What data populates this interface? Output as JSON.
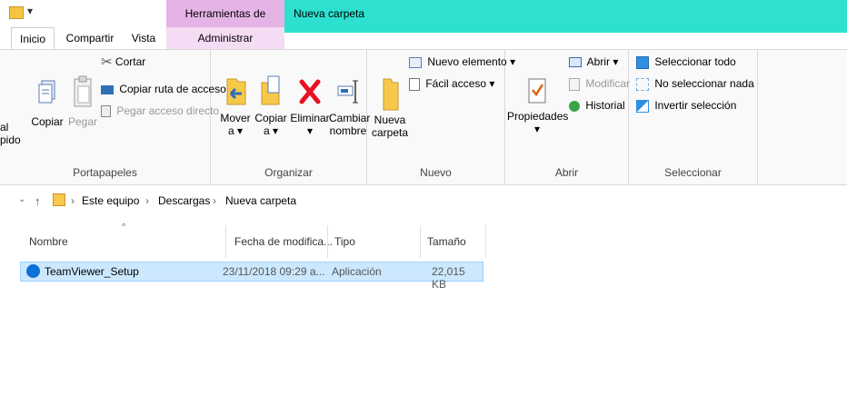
{
  "titlebar": {
    "app_tools_label": "Herramientas de aplicación",
    "window_title": "Nueva carpeta"
  },
  "tabs": {
    "inicio": "Inicio",
    "compartir": "Compartir",
    "vista": "Vista",
    "administrar": "Administrar"
  },
  "ribbon": {
    "portapapeles": {
      "label": "Portapapeles",
      "cut_partial_top": "al",
      "cut_partial_bottom": "pido",
      "copy": "Copiar",
      "paste": "Pegar",
      "cut": "Cortar",
      "copy_path": "Copiar ruta de acceso",
      "paste_shortcut": "Pegar acceso directo"
    },
    "organizar": {
      "label": "Organizar",
      "move_line1": "Mover",
      "move_line2": "a ▾",
      "copy_line1": "Copiar",
      "copy_line2": "a ▾",
      "delete_line1": "Eliminar",
      "delete_line2": "▾",
      "rename_line1": "Cambiar",
      "rename_line2": "nombre"
    },
    "nuevo": {
      "label": "Nuevo",
      "folder_line1": "Nueva",
      "folder_line2": "carpeta",
      "new_item": "Nuevo elemento ▾",
      "easy_access": "Fácil acceso ▾"
    },
    "abrir": {
      "label": "Abrir",
      "properties_line1": "Propiedades",
      "properties_line2": "▾",
      "open": "Abrir ▾",
      "modify": "Modificar",
      "history": "Historial"
    },
    "seleccionar": {
      "label": "Seleccionar",
      "select_all": "Seleccionar todo",
      "select_none": "No seleccionar nada",
      "invert": "Invertir selección"
    }
  },
  "address": {
    "crumb1": "Este equipo",
    "crumb2": "Descargas",
    "crumb3": "Nueva carpeta"
  },
  "columns": {
    "name": "Nombre",
    "date": "Fecha de modifica...",
    "type": "Tipo",
    "size": "Tamaño"
  },
  "files": [
    {
      "name": "TeamViewer_Setup",
      "date": "23/11/2018 09:29 a...",
      "type": "Aplicación",
      "size": "22,015 KB"
    }
  ],
  "colors": {
    "context_app_tools": "#e6b3e6",
    "context_title": "#2ee0d0",
    "selection": "#cce8ff",
    "delete_red": "#e81123"
  }
}
